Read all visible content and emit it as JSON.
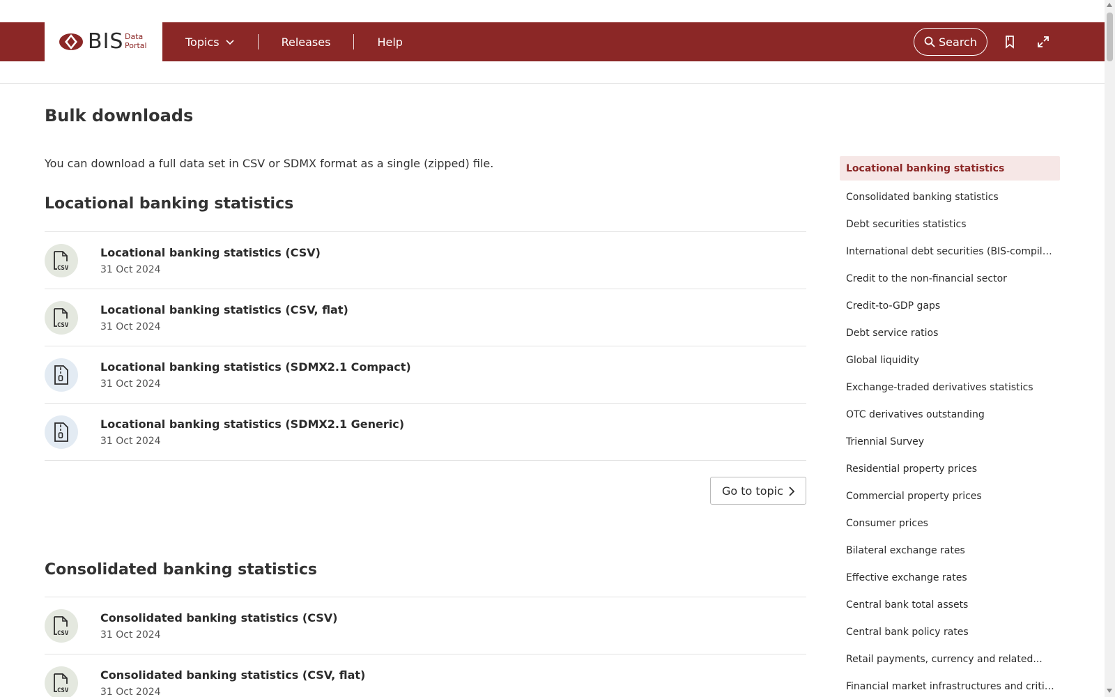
{
  "header": {
    "logo_text": "BIS",
    "logo_sub_line1": "Data",
    "logo_sub_line2": "Portal",
    "nav": [
      {
        "label": "Topics"
      },
      {
        "label": "Releases"
      },
      {
        "label": "Help"
      }
    ],
    "search_label": "Search",
    "icons": [
      "bookmark-icon",
      "expand-icon"
    ]
  },
  "main": {
    "title": "Bulk downloads",
    "intro": "You can download a full data set in CSV or SDMX format as a single (zipped) file.",
    "sections": [
      {
        "title": "Locational banking statistics",
        "items": [
          {
            "name": "Locational banking statistics (CSV)",
            "date": "31 Oct 2024",
            "icon": "csv-file-icon"
          },
          {
            "name": "Locational banking statistics (CSV, flat)",
            "date": "31 Oct 2024",
            "icon": "csv-file-icon"
          },
          {
            "name": "Locational banking statistics (SDMX2.1 Compact)",
            "date": "31 Oct 2024",
            "icon": "zip-file-icon"
          },
          {
            "name": "Locational banking statistics (SDMX2.1 Generic)",
            "date": "31 Oct 2024",
            "icon": "zip-file-icon"
          }
        ],
        "goto_label": "Go to topic"
      },
      {
        "title": "Consolidated banking statistics",
        "items": [
          {
            "name": "Consolidated banking statistics (CSV)",
            "date": "31 Oct 2024",
            "icon": "csv-file-icon"
          },
          {
            "name": "Consolidated banking statistics (CSV, flat)",
            "date": "31 Oct 2024",
            "icon": "csv-file-icon"
          }
        ]
      }
    ]
  },
  "sidenav": {
    "items": [
      {
        "label": "Locational banking statistics",
        "active": true
      },
      {
        "label": "Consolidated banking statistics"
      },
      {
        "label": "Debt securities statistics"
      },
      {
        "label": "International debt securities (BIS-compiled)"
      },
      {
        "label": "Credit to the non-financial sector"
      },
      {
        "label": "Credit-to-GDP gaps"
      },
      {
        "label": "Debt service ratios"
      },
      {
        "label": "Global liquidity"
      },
      {
        "label": "Exchange-traded derivatives statistics"
      },
      {
        "label": "OTC derivatives outstanding"
      },
      {
        "label": "Triennial Survey"
      },
      {
        "label": "Residential property prices"
      },
      {
        "label": "Commercial property prices"
      },
      {
        "label": "Consumer prices"
      },
      {
        "label": "Bilateral exchange rates"
      },
      {
        "label": "Effective exchange rates"
      },
      {
        "label": "Central bank total assets"
      },
      {
        "label": "Central bank policy rates"
      },
      {
        "label": "Retail payments, currency and related..."
      },
      {
        "label": "Financial market infrastructures and critic..."
      }
    ]
  },
  "colors": {
    "brand": "#8b2726",
    "active_bg": "#f6e7e6",
    "csv_icon_bg": "#e4e8df",
    "sdmx_icon_bg": "#e3ebf3"
  }
}
